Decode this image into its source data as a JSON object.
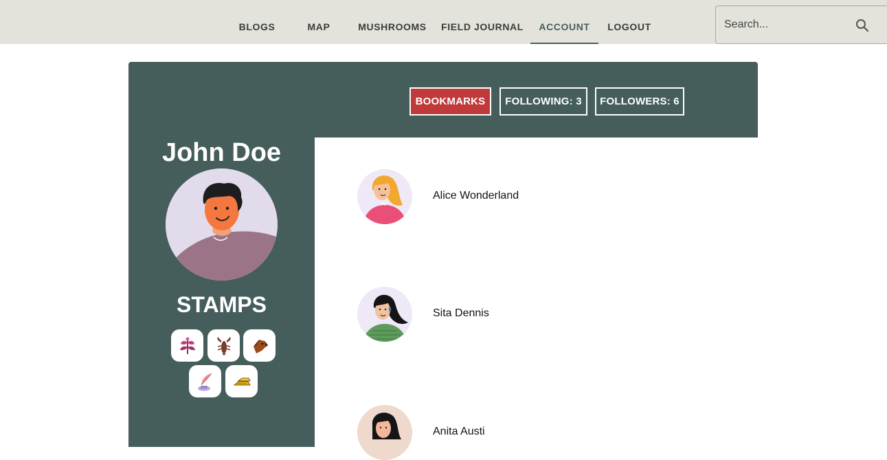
{
  "nav": {
    "items": [
      {
        "label": "BLOGS"
      },
      {
        "label": "MAP"
      },
      {
        "label": "MUSHROOMS"
      },
      {
        "label": "FIELD JOURNAL"
      },
      {
        "label": "ACCOUNT",
        "active": true
      },
      {
        "label": "LOGOUT"
      }
    ],
    "search": {
      "placeholder": "Search...",
      "icon": "search-icon"
    }
  },
  "profile": {
    "name": "John Doe",
    "avatar_icon": "user-avatar",
    "stamps_title": "STAMPS",
    "stamps": [
      {
        "icon": "flower-stamp-icon"
      },
      {
        "icon": "lobster-stamp-icon"
      },
      {
        "icon": "dog-stamp-icon"
      },
      {
        "icon": "feather-inkwell-stamp-icon"
      },
      {
        "icon": "gold-bars-stamp-icon"
      }
    ]
  },
  "tabs": [
    {
      "label": "BOOKMARKS",
      "active": true
    },
    {
      "label": "FOLLOWING: 3"
    },
    {
      "label": "FOLLOWERS: 6"
    }
  ],
  "people": [
    {
      "name": "Alice Wonderland"
    },
    {
      "name": "Sita Dennis"
    },
    {
      "name": "Anita Austi"
    }
  ],
  "colors": {
    "navbar": "#e3e3dc",
    "card": "#455e5b",
    "active_tab": "#c0393b",
    "white": "#ffffff"
  }
}
